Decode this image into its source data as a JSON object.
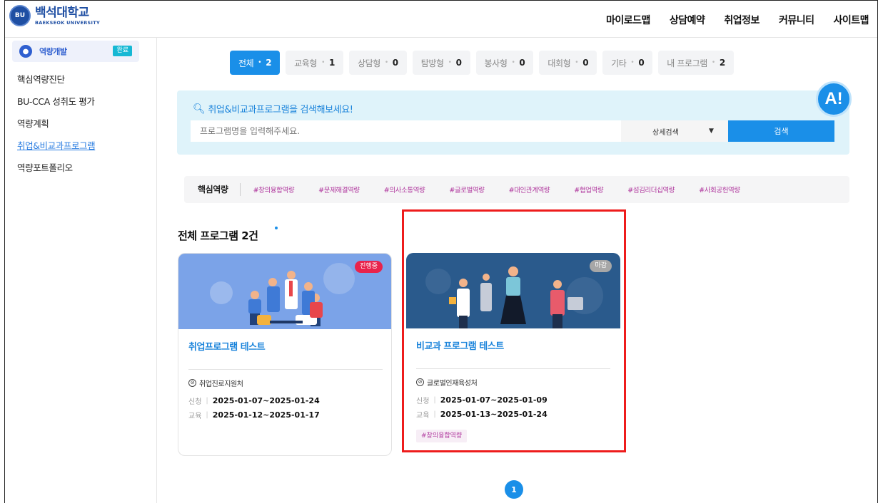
{
  "header": {
    "logo_ko": "백석대학교",
    "logo_en": "BAEKSEOK UNIVERSITY",
    "logo_emblem": "BU",
    "nav": [
      "마이로드맵",
      "상담예약",
      "취업정보",
      "커뮤니티",
      "사이트맵"
    ]
  },
  "sidebar": {
    "section": "역량개발",
    "badge": "완료",
    "items": [
      "핵심역량진단",
      "BU-CCA 성취도 평가",
      "역량계획",
      "취업&비교과프로그램",
      "역량포트폴리오"
    ],
    "active_index": 3
  },
  "tabs": [
    {
      "label": "전체",
      "count": "2",
      "active": true
    },
    {
      "label": "교육형",
      "count": "1"
    },
    {
      "label": "상담형",
      "count": "0"
    },
    {
      "label": "탐방형",
      "count": "0"
    },
    {
      "label": "봉사형",
      "count": "0"
    },
    {
      "label": "대회형",
      "count": "0"
    },
    {
      "label": "기타",
      "count": "0"
    },
    {
      "label": "내 프로그램",
      "count": "2"
    }
  ],
  "search": {
    "title": "취업&비교과프로그램을 검색해보세요!",
    "placeholder": "프로그램명을 입력해주세요.",
    "detail_label": "상세검색",
    "button_label": "검색"
  },
  "ai_button": "A!",
  "competency": {
    "label": "핵심역량",
    "tags": [
      "#창의융합역량",
      "#문제해결역량",
      "#의사소통역량",
      "#글로벌역량",
      "#대인관계역량",
      "#협업역량",
      "#섬김리더십역량",
      "#사회공헌역량"
    ]
  },
  "list": {
    "title": "전체 프로그램 2건"
  },
  "cards": [
    {
      "status": "진행중",
      "title": "취업프로그램 테스트",
      "org": "취업진로지원처",
      "apply_label": "신청",
      "apply_period": "2025-01-07~2025-01-24",
      "edu_label": "교육",
      "edu_period": "2025-01-12~2025-01-17"
    },
    {
      "status": "마감",
      "title": "비교과 프로그램 테스트",
      "org": "글로벌인재육성처",
      "apply_label": "신청",
      "apply_period": "2025-01-07~2025-01-09",
      "edu_label": "교육",
      "edu_period": "2025-01-13~2025-01-24",
      "tag": "#창의융합역량"
    }
  ],
  "pagination": {
    "current": "1"
  },
  "colors": {
    "accent": "#1a8fe8",
    "highlight": "#ee1c1c",
    "tag": "#b0389e"
  }
}
